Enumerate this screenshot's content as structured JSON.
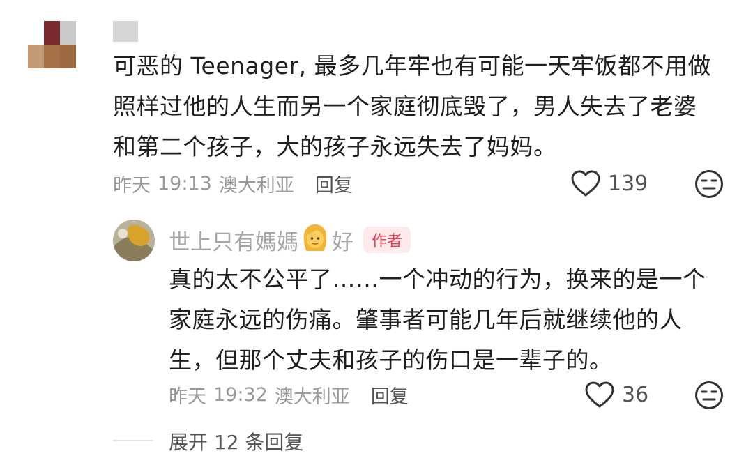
{
  "comment": {
    "text_lines": [
      "可恶的 Teenager, 最多几年牢也有可能一天牢饭都不用做",
      "照样过他的人生而另一个家庭彻底毁了，男人失去了老婆",
      "和第二个孩子，大的孩子永远失去了妈妈。"
    ],
    "meta": {
      "date": "昨天",
      "time": "19:13",
      "region": "澳大利亚",
      "reply_label": "回复"
    },
    "like_count": "139",
    "like_icon": "heart-outline-icon",
    "dislike_icon": "neutral-face-icon"
  },
  "reply": {
    "username_prefix": "世上只有媽媽",
    "username_emoji": "woman-face-emoji",
    "username_suffix": "好",
    "author_badge": "作者",
    "text_lines": [
      "真的太不公平了……一个冲动的行为，换来的是一个",
      "家庭永远的伤痛。肇事者可能几年后就继续他的人",
      "生，但那个丈夫和孩子的伤口是一辈子的。"
    ],
    "meta": {
      "date": "昨天",
      "time": "19:32",
      "region": "澳大利亚",
      "reply_label": "回复"
    },
    "like_count": "36",
    "like_icon": "heart-outline-icon",
    "dislike_icon": "neutral-face-icon"
  },
  "expand_replies": "展开 12 条回复",
  "colors": {
    "text": "#1f1f1f",
    "meta_text": "#9a9a9a",
    "action_text": "#555555",
    "badge_bg": "#fde8ea",
    "badge_text": "#e24459"
  }
}
